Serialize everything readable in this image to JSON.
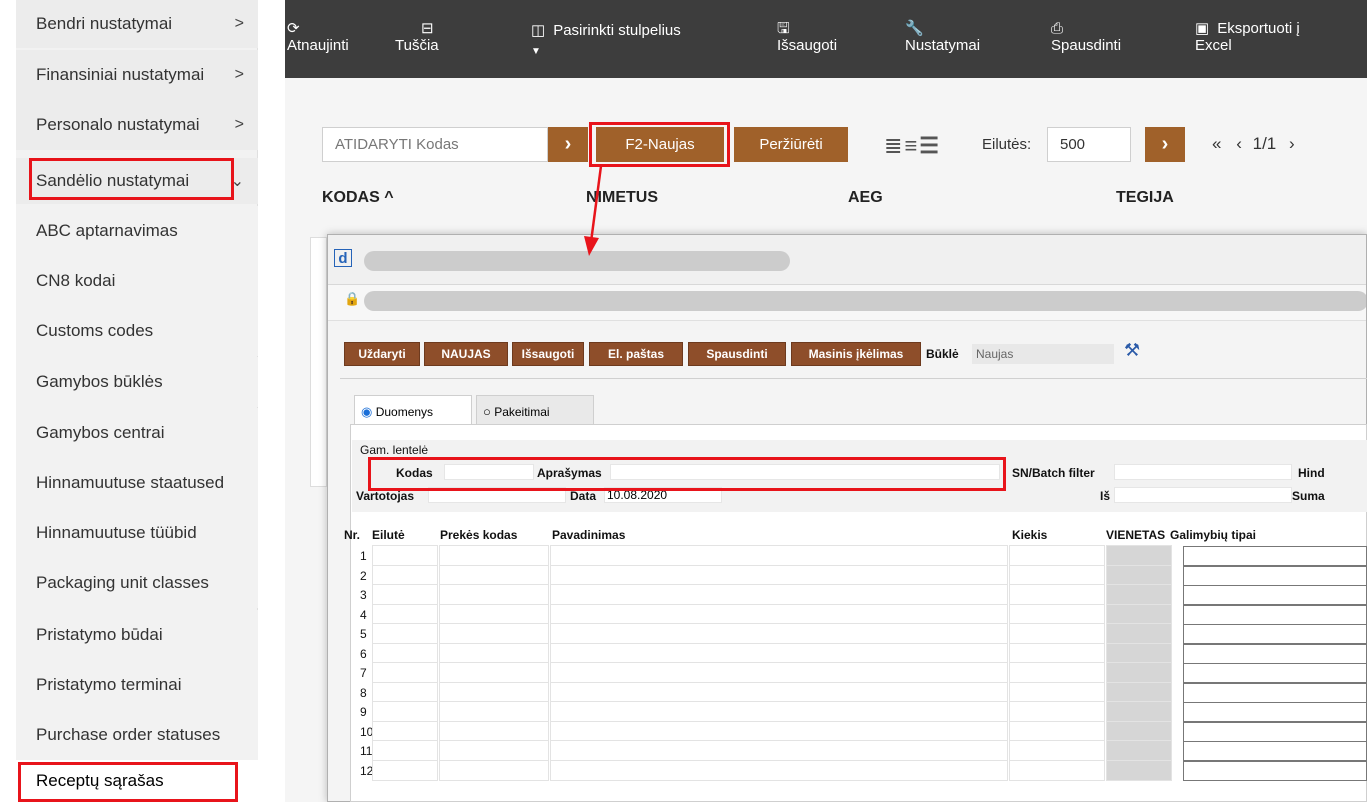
{
  "sidebar": {
    "items": [
      {
        "label": "Bendri nustatymai",
        "chevron": ">"
      },
      {
        "label": "Finansiniai nustatymai",
        "chevron": ">"
      },
      {
        "label": "Personalo nustatymai",
        "chevron": ">"
      },
      {
        "label": "Sandėlio nustatymai",
        "chevron": "⌄"
      },
      {
        "label": "ABC aptarnavimas"
      },
      {
        "label": "CN8 kodai"
      },
      {
        "label": "Customs codes"
      },
      {
        "label": "Gamybos būklės"
      },
      {
        "label": "Gamybos centrai"
      },
      {
        "label": "Hinnamuutuse staatused"
      },
      {
        "label": "Hinnamuutuse tüübid"
      },
      {
        "label": "Packaging unit classes"
      },
      {
        "label": "Pristatymo būdai"
      },
      {
        "label": "Pristatymo terminai"
      },
      {
        "label": "Purchase order statuses"
      },
      {
        "label": "Receptų sąrašas"
      }
    ]
  },
  "toolbar": {
    "refresh": {
      "icon": "refresh-icon",
      "label": "Atnaujinti"
    },
    "empty": {
      "icon": "minus-box-icon",
      "label": "Tuščia"
    },
    "columns": {
      "icon": "columns-icon",
      "label": "Pasirinkti stulpelius"
    },
    "save": {
      "icon": "save-icon",
      "label": "Išsaugoti"
    },
    "settings": {
      "icon": "wrench-icon",
      "label": "Nustatymai"
    },
    "print": {
      "icon": "printer-icon",
      "label": "Spausdinti"
    },
    "export": {
      "icon": "excel-icon",
      "label_1": "Eksportuoti į",
      "label_2": "Excel"
    }
  },
  "search": {
    "placeholder": "ATIDARYTI Kodas",
    "new_button": "F2-Naujas",
    "view_button": "Peržiūrėti",
    "rows_label": "Eilutės:",
    "rows_value": "500",
    "pagination": "1/1"
  },
  "table_headers": {
    "kodas": "KODAS ^",
    "nimetus": "NIMETUS",
    "aeg": "AEG",
    "tegija": "TEGIJA"
  },
  "popup": {
    "logo": "d",
    "buttons": [
      "Uždaryti",
      "NAUJAS",
      "Išsaugoti",
      "El. paštas",
      "Spausdinti",
      "Masinis įkėlimas"
    ],
    "status_label": "Būklė",
    "status_value": "Naujas",
    "tabs": {
      "data": "Duomenys",
      "changes": "Pakeitimai"
    },
    "section_title": "Gam. lentelė",
    "fields": {
      "kodas": "Kodas",
      "aprasymas": "Aprašymas",
      "sn_batch": "SN/Batch filter",
      "hind": "Hind",
      "vartotojas": "Vartotojas",
      "data_label": "Data",
      "data_value": "10.08.2020",
      "is": "Iš",
      "suma": "Suma"
    },
    "grid_headers": {
      "nr": "Nr.",
      "eilute": "Eilutė",
      "prekes_kodas": "Prekės kodas",
      "pavadinimas": "Pavadinimas",
      "kiekis": "Kiekis",
      "vienetas": "VIENETAS",
      "galimybiu": "Galimybių tipai"
    },
    "row_numbers": [
      "1",
      "2",
      "3",
      "4",
      "5",
      "6",
      "7",
      "8",
      "9",
      "10",
      "11",
      "12"
    ]
  },
  "colors": {
    "accent_brown": "#a0612a",
    "popup_button": "#8e4e2a",
    "highlight_red": "#e8141b",
    "toolbar": "#3d3d3d"
  }
}
